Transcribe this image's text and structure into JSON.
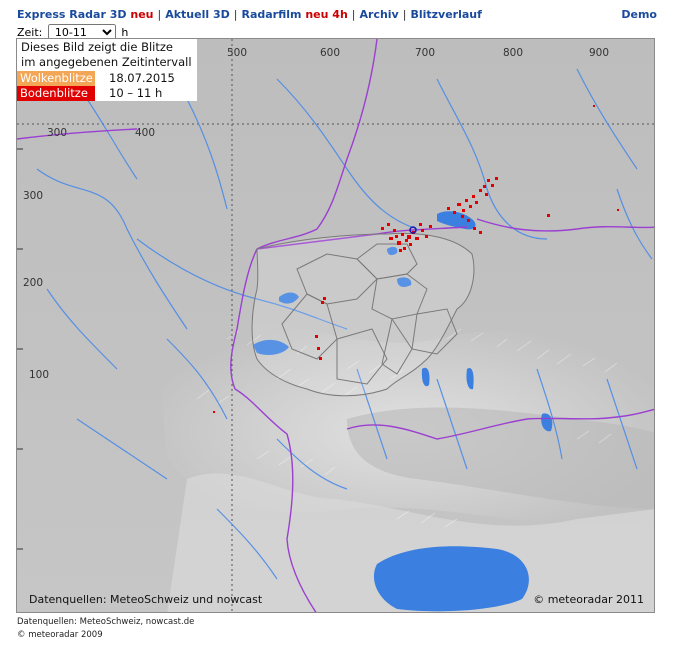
{
  "nav": {
    "items": [
      {
        "label": "Express Radar 3D",
        "tag": "neu"
      },
      {
        "label": "Aktuell 3D",
        "tag": ""
      },
      {
        "label": "Radarfilm",
        "tag": "neu 4h"
      },
      {
        "label": "Archiv",
        "tag": ""
      },
      {
        "label": "Blitzverlauf",
        "tag": ""
      }
    ],
    "demo": "Demo"
  },
  "zeit": {
    "label": "Zeit:",
    "selected": "10-11",
    "unit": "h"
  },
  "legend": {
    "info_line1": "Dieses Bild zeigt die Blitze",
    "info_line2": "im angegebenen Zeitintervall",
    "wolken_label": "Wolkenblitze",
    "wolken_value": "18.07.2015",
    "boden_label": "Bodenblitze",
    "boden_value": "10 – 11  h"
  },
  "map": {
    "source_text": "Datenquellen: MeteoSchweiz und nowcast",
    "copyright_text": "© meteoradar 2011",
    "grid_labels_top": [
      "500",
      "600",
      "700",
      "800",
      "900"
    ],
    "grid_labels_left": [
      "300",
      "200",
      "100"
    ],
    "grid_labels_inner": [
      "300",
      "400"
    ]
  },
  "footer": {
    "source": "Datenquellen: MeteoSchweiz, nowcast.de",
    "copyright": "© meteoradar 2009"
  },
  "colors": {
    "lightning": "#e00000",
    "water": "#3b7fe0",
    "rivers": "#4a8ae8",
    "border_purple": "#9b3fd1",
    "nav_link": "#1a4a9c"
  }
}
